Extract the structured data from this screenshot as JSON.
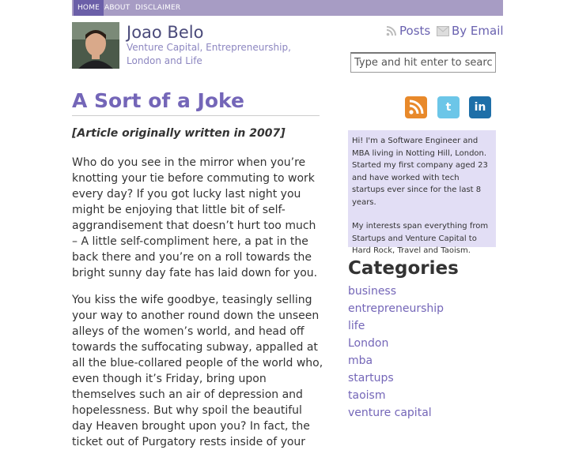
{
  "nav": {
    "items": [
      "HOME",
      "ABOUT",
      "DISCLAIMER"
    ]
  },
  "header": {
    "title": "Joao Belo",
    "tagline": "Venture Capital, Entrepreneurship, London and Life",
    "posts_link": "Posts",
    "email_link": "By Email"
  },
  "search": {
    "placeholder": "Type and hit enter to search"
  },
  "post": {
    "title": "A Sort of a Joke",
    "note": "[Article originally written in 2007]",
    "paragraphs": [
      "Who do you see in the mirror when you’re knotting your tie before commuting to work every day? If you got lucky last night you might be enjoying that little bit of self-aggrandisement that doesn’t hurt too much – A little self-compliment here, a pat in the back there and you’re on a roll towards the bright sunny day fate has laid down for you.",
      "You kiss the wife goodbye, teasingly selling your way to another round down the unseen alleys of the women’s world, and head off towards the suffocating subway, appalled at all the blue-collared people of the world who, even though it’s Friday, bring upon themselves such an air of depression and hopelessness. But why spoil the beautiful day Heaven brought upon you? In fact, the ticket out of Purgatory rests inside of your"
    ]
  },
  "social": {
    "icons": [
      "rss-icon",
      "twitter-icon",
      "linkedin-icon"
    ],
    "colors": [
      "#e8892a",
      "#6cc6e8",
      "#1e6fa8"
    ]
  },
  "bio": {
    "p1": "Hi! I'm a Software Engineer and MBA living in Notting Hill, London. Started my first company aged 23 and have worked with tech startups ever since for the last 8 years.",
    "p2": "My interests span everything from Startups and Venture Capital to Hard Rock, Travel and Taoism."
  },
  "categories": {
    "heading": "Categories",
    "items": [
      "business",
      "entrepreneurship",
      "life",
      "London",
      "mba",
      "startups",
      "taoism",
      "venture capital"
    ]
  },
  "colors": {
    "accent": "#7466b8",
    "nav_bar": "#a79cc4",
    "nav_active": "#6b5fa8",
    "bio_bg": "#e2def5"
  }
}
